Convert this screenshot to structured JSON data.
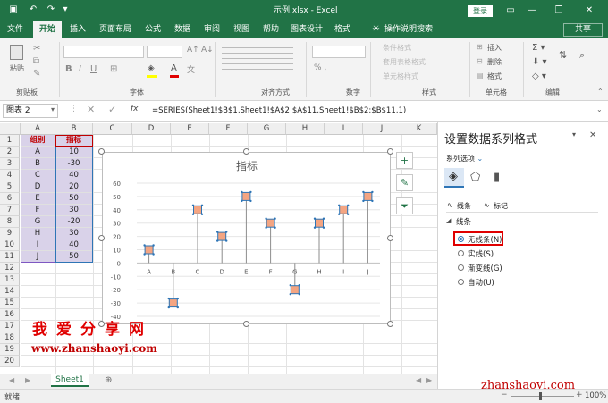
{
  "window": {
    "title": "示例.xlsx - Excel",
    "login_label": "登录",
    "min": "—",
    "restore": "❐",
    "close": "✕"
  },
  "tabs": [
    {
      "label": "文件",
      "active": false
    },
    {
      "label": "开始",
      "active": true
    },
    {
      "label": "插入",
      "active": false
    },
    {
      "label": "页面布局",
      "active": false
    },
    {
      "label": "公式",
      "active": false
    },
    {
      "label": "数据",
      "active": false
    },
    {
      "label": "审阅",
      "active": false
    },
    {
      "label": "视图",
      "active": false
    },
    {
      "label": "帮助",
      "active": false
    },
    {
      "label": "图表设计",
      "active": false
    },
    {
      "label": "格式",
      "active": false
    }
  ],
  "search_label": "操作说明搜索",
  "share_label": "共享",
  "ribbon": {
    "groups": [
      "剪贴板",
      "字体",
      "对齐方式",
      "数字",
      "样式",
      "单元格",
      "编辑"
    ],
    "paste_label": "粘贴",
    "styles": [
      "条件格式",
      "套用表格格式",
      "单元格样式"
    ],
    "cells": [
      "插入",
      "删除",
      "格式"
    ]
  },
  "formula_bar": {
    "name_box": "图表 2",
    "fx": "fx",
    "formula": "=SERIES(Sheet1!$B$1,Sheet1!$A$2:$A$11,Sheet1!$B$2:$B$11,1)"
  },
  "columns": [
    "A",
    "B",
    "C",
    "D",
    "E",
    "F",
    "G",
    "H",
    "I",
    "J",
    "K"
  ],
  "rows": [
    "1",
    "2",
    "3",
    "4",
    "5",
    "6",
    "7",
    "8",
    "9",
    "10",
    "11",
    "12",
    "13",
    "14",
    "15",
    "16",
    "17",
    "18",
    "19",
    "20"
  ],
  "table": {
    "headers": [
      "组别",
      "指标"
    ],
    "rows": [
      [
        "A",
        "10"
      ],
      [
        "B",
        "-30"
      ],
      [
        "C",
        "40"
      ],
      [
        "D",
        "20"
      ],
      [
        "E",
        "50"
      ],
      [
        "F",
        "30"
      ],
      [
        "G",
        "-20"
      ],
      [
        "H",
        "30"
      ],
      [
        "I",
        "40"
      ],
      [
        "J",
        "50"
      ]
    ]
  },
  "chart_data": {
    "type": "scatter",
    "title": "指标",
    "categories": [
      "A",
      "B",
      "C",
      "D",
      "E",
      "F",
      "G",
      "H",
      "I",
      "J"
    ],
    "series": [
      {
        "name": "指标",
        "values": [
          10,
          -30,
          40,
          20,
          50,
          30,
          -20,
          30,
          40,
          50
        ]
      }
    ],
    "ylim": [
      -40,
      60
    ],
    "yticks": [
      "60",
      "50",
      "40",
      "30",
      "20",
      "10",
      "0",
      "-10",
      "-20",
      "-30",
      "-40"
    ],
    "grid": true,
    "drop_lines": true,
    "marker_color": "#f4a582",
    "marker_border": "#2e75b6"
  },
  "chart_tools": {
    "add": "+",
    "style": "✎",
    "filter": "⏷"
  },
  "watermark": {
    "cn": "我爱分享网",
    "url": "www.zhanshaoyi.com",
    "url2": "zhanshaoyi.com"
  },
  "pane": {
    "title": "设置数据系列格式",
    "series_options": "系列选项",
    "tab_line": "线条",
    "tab_marker": "标记",
    "section": "线条",
    "options": [
      {
        "label": "无线条(N)",
        "selected": true
      },
      {
        "label": "实线(S)",
        "selected": false
      },
      {
        "label": "渐变线(G)",
        "selected": false
      },
      {
        "label": "自动(U)",
        "selected": false
      }
    ],
    "close": "✕"
  },
  "sheet_tab": "Sheet1",
  "status": {
    "ready": "就绪",
    "zoom": "100%"
  },
  "colors": {
    "accent": "#217346",
    "highlight": "#e00000",
    "cell_fill": "#d9d2e9"
  }
}
